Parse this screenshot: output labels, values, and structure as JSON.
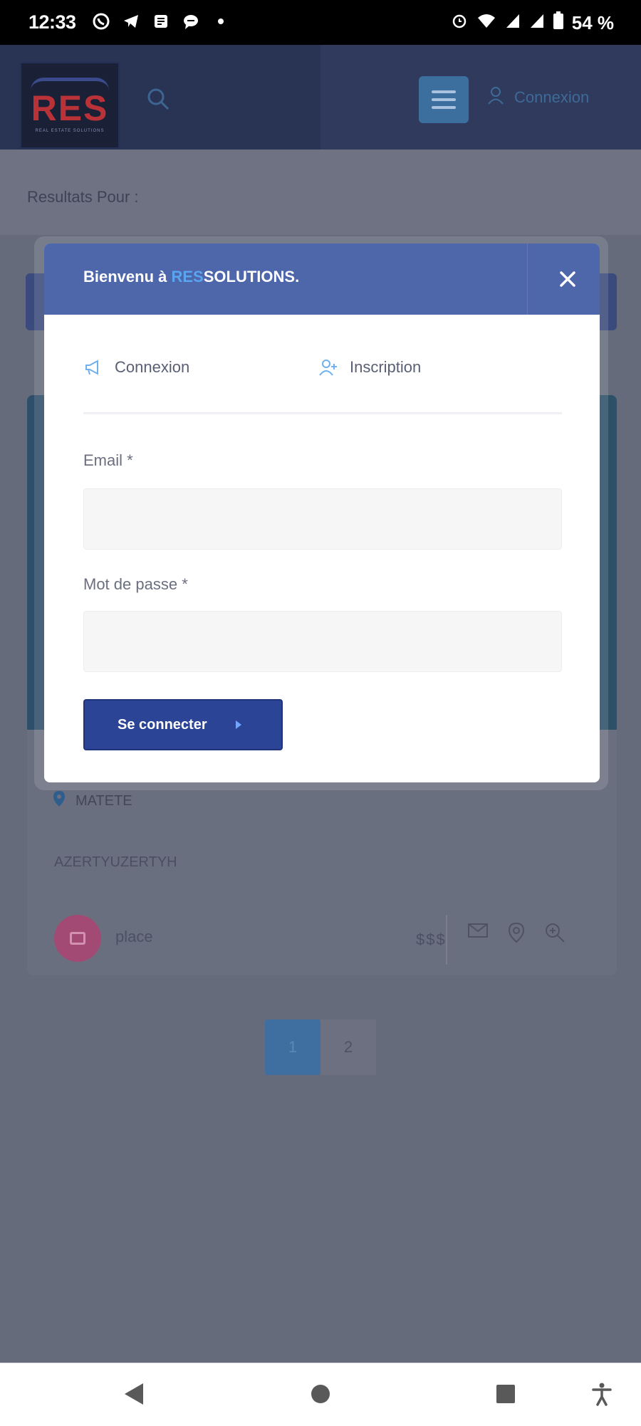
{
  "status_bar": {
    "time": "12:33",
    "battery": "54 %",
    "icons": [
      "whatsapp-icon",
      "telegram-icon",
      "news-icon",
      "chat-icon",
      "dot-icon",
      "alarm-icon",
      "wifi-icon",
      "signal-icon",
      "signal-icon",
      "battery-icon"
    ]
  },
  "header": {
    "logo_text": "RES",
    "logo_tagline": "REAL ESTATE SOLUTIONS",
    "login_label": "Connexion"
  },
  "results": {
    "label": "Resultats Pour :"
  },
  "listing": {
    "location": "MATETE",
    "description": "AZERTYUZERTYH",
    "category": "place",
    "price": "$$$"
  },
  "pagination": {
    "pages": [
      "1",
      "2"
    ],
    "active": "1"
  },
  "modal": {
    "title_prefix": "Bienvenu à ",
    "title_highlight": "RES",
    "title_suffix": "SOLUTIONS.",
    "tabs": {
      "login": "Connexion",
      "register": "Inscription"
    },
    "email_label": "Email *",
    "email_value": "",
    "password_label": "Mot de passe *",
    "password_value": "",
    "submit_label": "Se connecter"
  },
  "colors": {
    "modal_header": "#4e66aa",
    "accent": "#59a5f0",
    "button": "#2c4495",
    "overlay": "#666b7c"
  }
}
